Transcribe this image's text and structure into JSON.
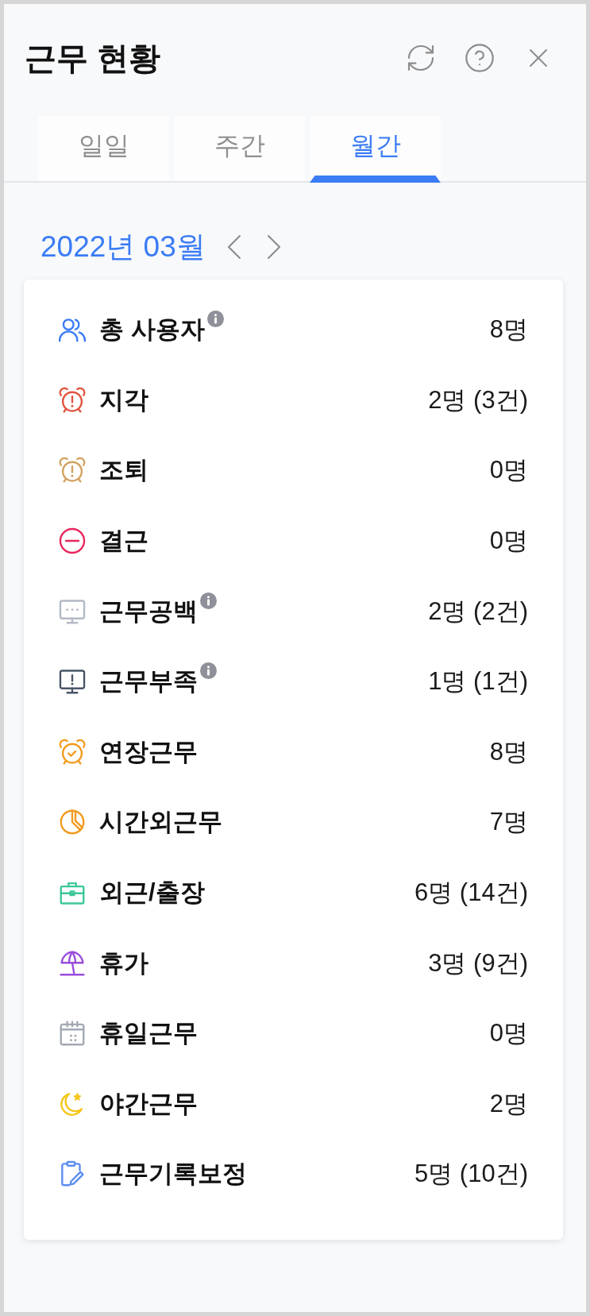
{
  "header": {
    "title": "근무 현황"
  },
  "tabs": [
    {
      "label": "일일",
      "selected": false
    },
    {
      "label": "주간",
      "selected": false
    },
    {
      "label": "월간",
      "selected": true
    }
  ],
  "period": {
    "label": "2022년 03월"
  },
  "stats": [
    {
      "kind": "users",
      "label": "총 사용자",
      "info": true,
      "value": "8명",
      "color": "#3b7cf5"
    },
    {
      "kind": "alarm",
      "label": "지각",
      "info": false,
      "value": "2명 (3건)",
      "color": "#e0533d"
    },
    {
      "kind": "alarm",
      "label": "조퇴",
      "info": false,
      "value": "0명",
      "color": "#d3a15f"
    },
    {
      "kind": "minus",
      "label": "결근",
      "info": false,
      "value": "0명",
      "color": "#e8265e"
    },
    {
      "kind": "monitor-dots",
      "label": "근무공백",
      "info": true,
      "value": "2명 (2건)",
      "color": "#b3bac5"
    },
    {
      "kind": "monitor-alert",
      "label": "근무부족",
      "info": true,
      "value": "1명 (1건)",
      "color": "#4a5568"
    },
    {
      "kind": "alarm-check",
      "label": "연장근무",
      "info": false,
      "value": "8명",
      "color": "#f39a1e"
    },
    {
      "kind": "pie",
      "label": "시간외근무",
      "info": false,
      "value": "7명",
      "color": "#f39a1e"
    },
    {
      "kind": "briefcase",
      "label": "외근/출장",
      "info": false,
      "value": "6명 (14건)",
      "color": "#3cc79a"
    },
    {
      "kind": "umbrella",
      "label": "휴가",
      "info": false,
      "value": "3명 (9건)",
      "color": "#9b4ddb"
    },
    {
      "kind": "calendar",
      "label": "휴일근무",
      "info": false,
      "value": "0명",
      "color": "#a3a9b3"
    },
    {
      "kind": "moon",
      "label": "야간근무",
      "info": false,
      "value": "2명",
      "color": "#f5c518"
    },
    {
      "kind": "clipboard",
      "label": "근무기록보정",
      "info": false,
      "value": "5명 (10건)",
      "color": "#5b8def"
    }
  ]
}
